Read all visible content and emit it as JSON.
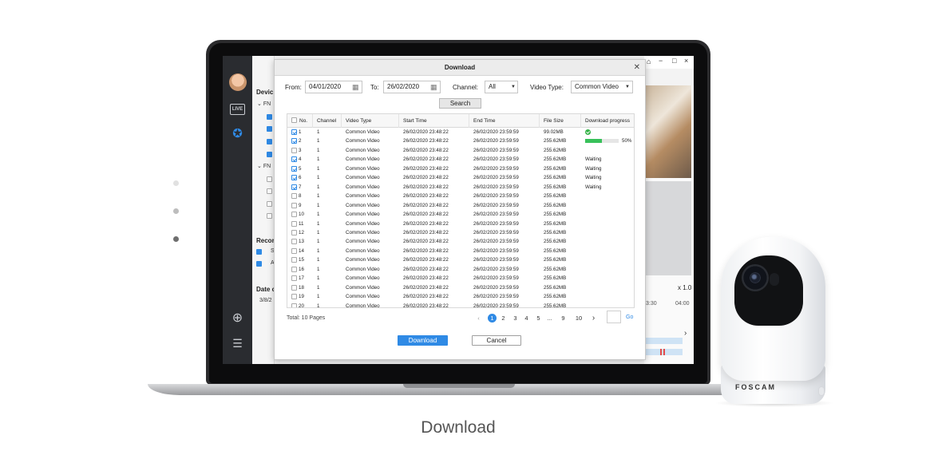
{
  "caption": "Download",
  "dialog": {
    "title": "Download",
    "from_label": "From:",
    "from_value": "04/01/2020",
    "to_label": "To:",
    "to_value": "26/02/2020",
    "channel_label": "Channel:",
    "channel_value": "All",
    "video_type_label": "Video Type:",
    "video_type_value": "Common Video",
    "search_label": "Search",
    "columns": [
      "No.",
      "Channel",
      "Video Type",
      "Start Time",
      "End Time",
      "File Size",
      "Download progress"
    ],
    "rows": [
      {
        "no": "1",
        "checked": true,
        "channel": "1",
        "type": "Common Video",
        "start": "26/02/2020 23:48:22",
        "end": "26/02/2020 23:59:59",
        "size": "99.02MB",
        "status": "done",
        "progress": 1.0,
        "progress_text": ""
      },
      {
        "no": "2",
        "checked": true,
        "channel": "1",
        "type": "Common Video",
        "start": "26/02/2020 23:48:22",
        "end": "26/02/2020 23:59:59",
        "size": "255.62MB",
        "status": "progress",
        "progress": 0.5,
        "progress_text": "50%"
      },
      {
        "no": "3",
        "checked": false,
        "channel": "1",
        "type": "Common Video",
        "start": "26/02/2020 23:48:22",
        "end": "26/02/2020 23:59:59",
        "size": "255.62MB",
        "status": "none",
        "progress_text": ""
      },
      {
        "no": "4",
        "checked": true,
        "channel": "1",
        "type": "Common Video",
        "start": "26/02/2020 23:48:22",
        "end": "26/02/2020 23:59:59",
        "size": "255.62MB",
        "status": "waiting",
        "progress_text": "Waiting"
      },
      {
        "no": "5",
        "checked": true,
        "channel": "1",
        "type": "Common Video",
        "start": "26/02/2020 23:48:22",
        "end": "26/02/2020 23:59:59",
        "size": "255.62MB",
        "status": "waiting",
        "progress_text": "Waiting"
      },
      {
        "no": "6",
        "checked": true,
        "channel": "1",
        "type": "Common Video",
        "start": "26/02/2020 23:48:22",
        "end": "26/02/2020 23:59:59",
        "size": "255.62MB",
        "status": "waiting",
        "progress_text": "Waiting"
      },
      {
        "no": "7",
        "checked": true,
        "channel": "1",
        "type": "Common Video",
        "start": "26/02/2020 23:48:22",
        "end": "26/02/2020 23:59:59",
        "size": "255.62MB",
        "status": "waiting",
        "progress_text": "Waiting"
      },
      {
        "no": "8",
        "checked": false,
        "channel": "1",
        "type": "Common Video",
        "start": "26/02/2020 23:48:22",
        "end": "26/02/2020 23:59:59",
        "size": "255.62MB",
        "status": "none",
        "progress_text": ""
      },
      {
        "no": "9",
        "checked": false,
        "channel": "1",
        "type": "Common Video",
        "start": "26/02/2020 23:48:22",
        "end": "26/02/2020 23:59:59",
        "size": "255.62MB",
        "status": "none",
        "progress_text": ""
      },
      {
        "no": "10",
        "checked": false,
        "channel": "1",
        "type": "Common Video",
        "start": "26/02/2020 23:48:22",
        "end": "26/02/2020 23:59:59",
        "size": "255.62MB",
        "status": "none",
        "progress_text": ""
      },
      {
        "no": "11",
        "checked": false,
        "channel": "1",
        "type": "Common Video",
        "start": "26/02/2020 23:48:22",
        "end": "26/02/2020 23:59:59",
        "size": "255.62MB",
        "status": "none",
        "progress_text": ""
      },
      {
        "no": "12",
        "checked": false,
        "channel": "1",
        "type": "Common Video",
        "start": "26/02/2020 23:48:22",
        "end": "26/02/2020 23:59:59",
        "size": "255.62MB",
        "status": "none",
        "progress_text": ""
      },
      {
        "no": "13",
        "checked": false,
        "channel": "1",
        "type": "Common Video",
        "start": "26/02/2020 23:48:22",
        "end": "26/02/2020 23:59:59",
        "size": "255.62MB",
        "status": "none",
        "progress_text": ""
      },
      {
        "no": "14",
        "checked": false,
        "channel": "1",
        "type": "Common Video",
        "start": "26/02/2020 23:48:22",
        "end": "26/02/2020 23:59:59",
        "size": "255.62MB",
        "status": "none",
        "progress_text": ""
      },
      {
        "no": "15",
        "checked": false,
        "channel": "1",
        "type": "Common Video",
        "start": "26/02/2020 23:48:22",
        "end": "26/02/2020 23:59:59",
        "size": "255.62MB",
        "status": "none",
        "progress_text": ""
      },
      {
        "no": "16",
        "checked": false,
        "channel": "1",
        "type": "Common Video",
        "start": "26/02/2020 23:48:22",
        "end": "26/02/2020 23:59:59",
        "size": "255.62MB",
        "status": "none",
        "progress_text": ""
      },
      {
        "no": "17",
        "checked": false,
        "channel": "1",
        "type": "Common Video",
        "start": "26/02/2020 23:48:22",
        "end": "26/02/2020 23:59:59",
        "size": "255.62MB",
        "status": "none",
        "progress_text": ""
      },
      {
        "no": "18",
        "checked": false,
        "channel": "1",
        "type": "Common Video",
        "start": "26/02/2020 23:48:22",
        "end": "26/02/2020 23:59:59",
        "size": "255.62MB",
        "status": "none",
        "progress_text": ""
      },
      {
        "no": "19",
        "checked": false,
        "channel": "1",
        "type": "Common Video",
        "start": "26/02/2020 23:48:22",
        "end": "26/02/2020 23:59:59",
        "size": "255.62MB",
        "status": "none",
        "progress_text": ""
      },
      {
        "no": "20",
        "checked": false,
        "channel": "1",
        "type": "Common Video",
        "start": "26/02/2020 23:48:22",
        "end": "26/02/2020 23:59:59",
        "size": "255.62MB",
        "status": "none",
        "progress_text": ""
      }
    ],
    "total_label": "Total: 10 Pages",
    "pages": [
      "1",
      "2",
      "3",
      "4",
      "5",
      "...",
      "9",
      "10"
    ],
    "current_page": "1",
    "go_label": "Go",
    "download_label": "Download",
    "cancel_label": "Cancel"
  },
  "background_app": {
    "device_header": "Devic",
    "tree_groups": [
      "FN",
      "FN"
    ],
    "record_header": "Recor",
    "record_items": [
      "S",
      "A"
    ],
    "date_header": "Date c",
    "date_value": "3/8/2",
    "zoom": "x 1.0",
    "timeline_ticks": [
      "3:30",
      "04:00"
    ],
    "live_icon_text": "LIVE"
  },
  "camera": {
    "brand": "FOSCAM"
  },
  "colors": {
    "accent": "#2f8ae5",
    "progress": "#38c15a",
    "done": "#38b34a"
  }
}
